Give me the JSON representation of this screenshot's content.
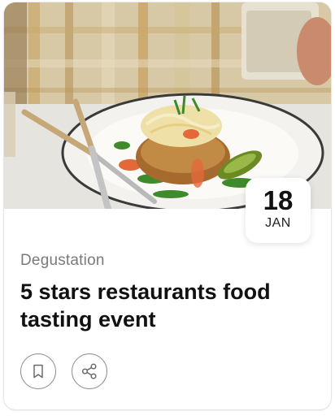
{
  "event": {
    "date_day": "18",
    "date_month": "JAN",
    "category": "Degustation",
    "title": "5 stars restaurants food tasting event"
  },
  "image": {
    "subject": "food-plate-photo"
  },
  "actions": {
    "bookmark_icon": "bookmark-icon",
    "share_icon": "share-icon"
  },
  "colors": {
    "title": "#111111",
    "category": "#7a7a7a",
    "button_border": "#8a8a8a",
    "badge_bg": "#ffffff"
  }
}
